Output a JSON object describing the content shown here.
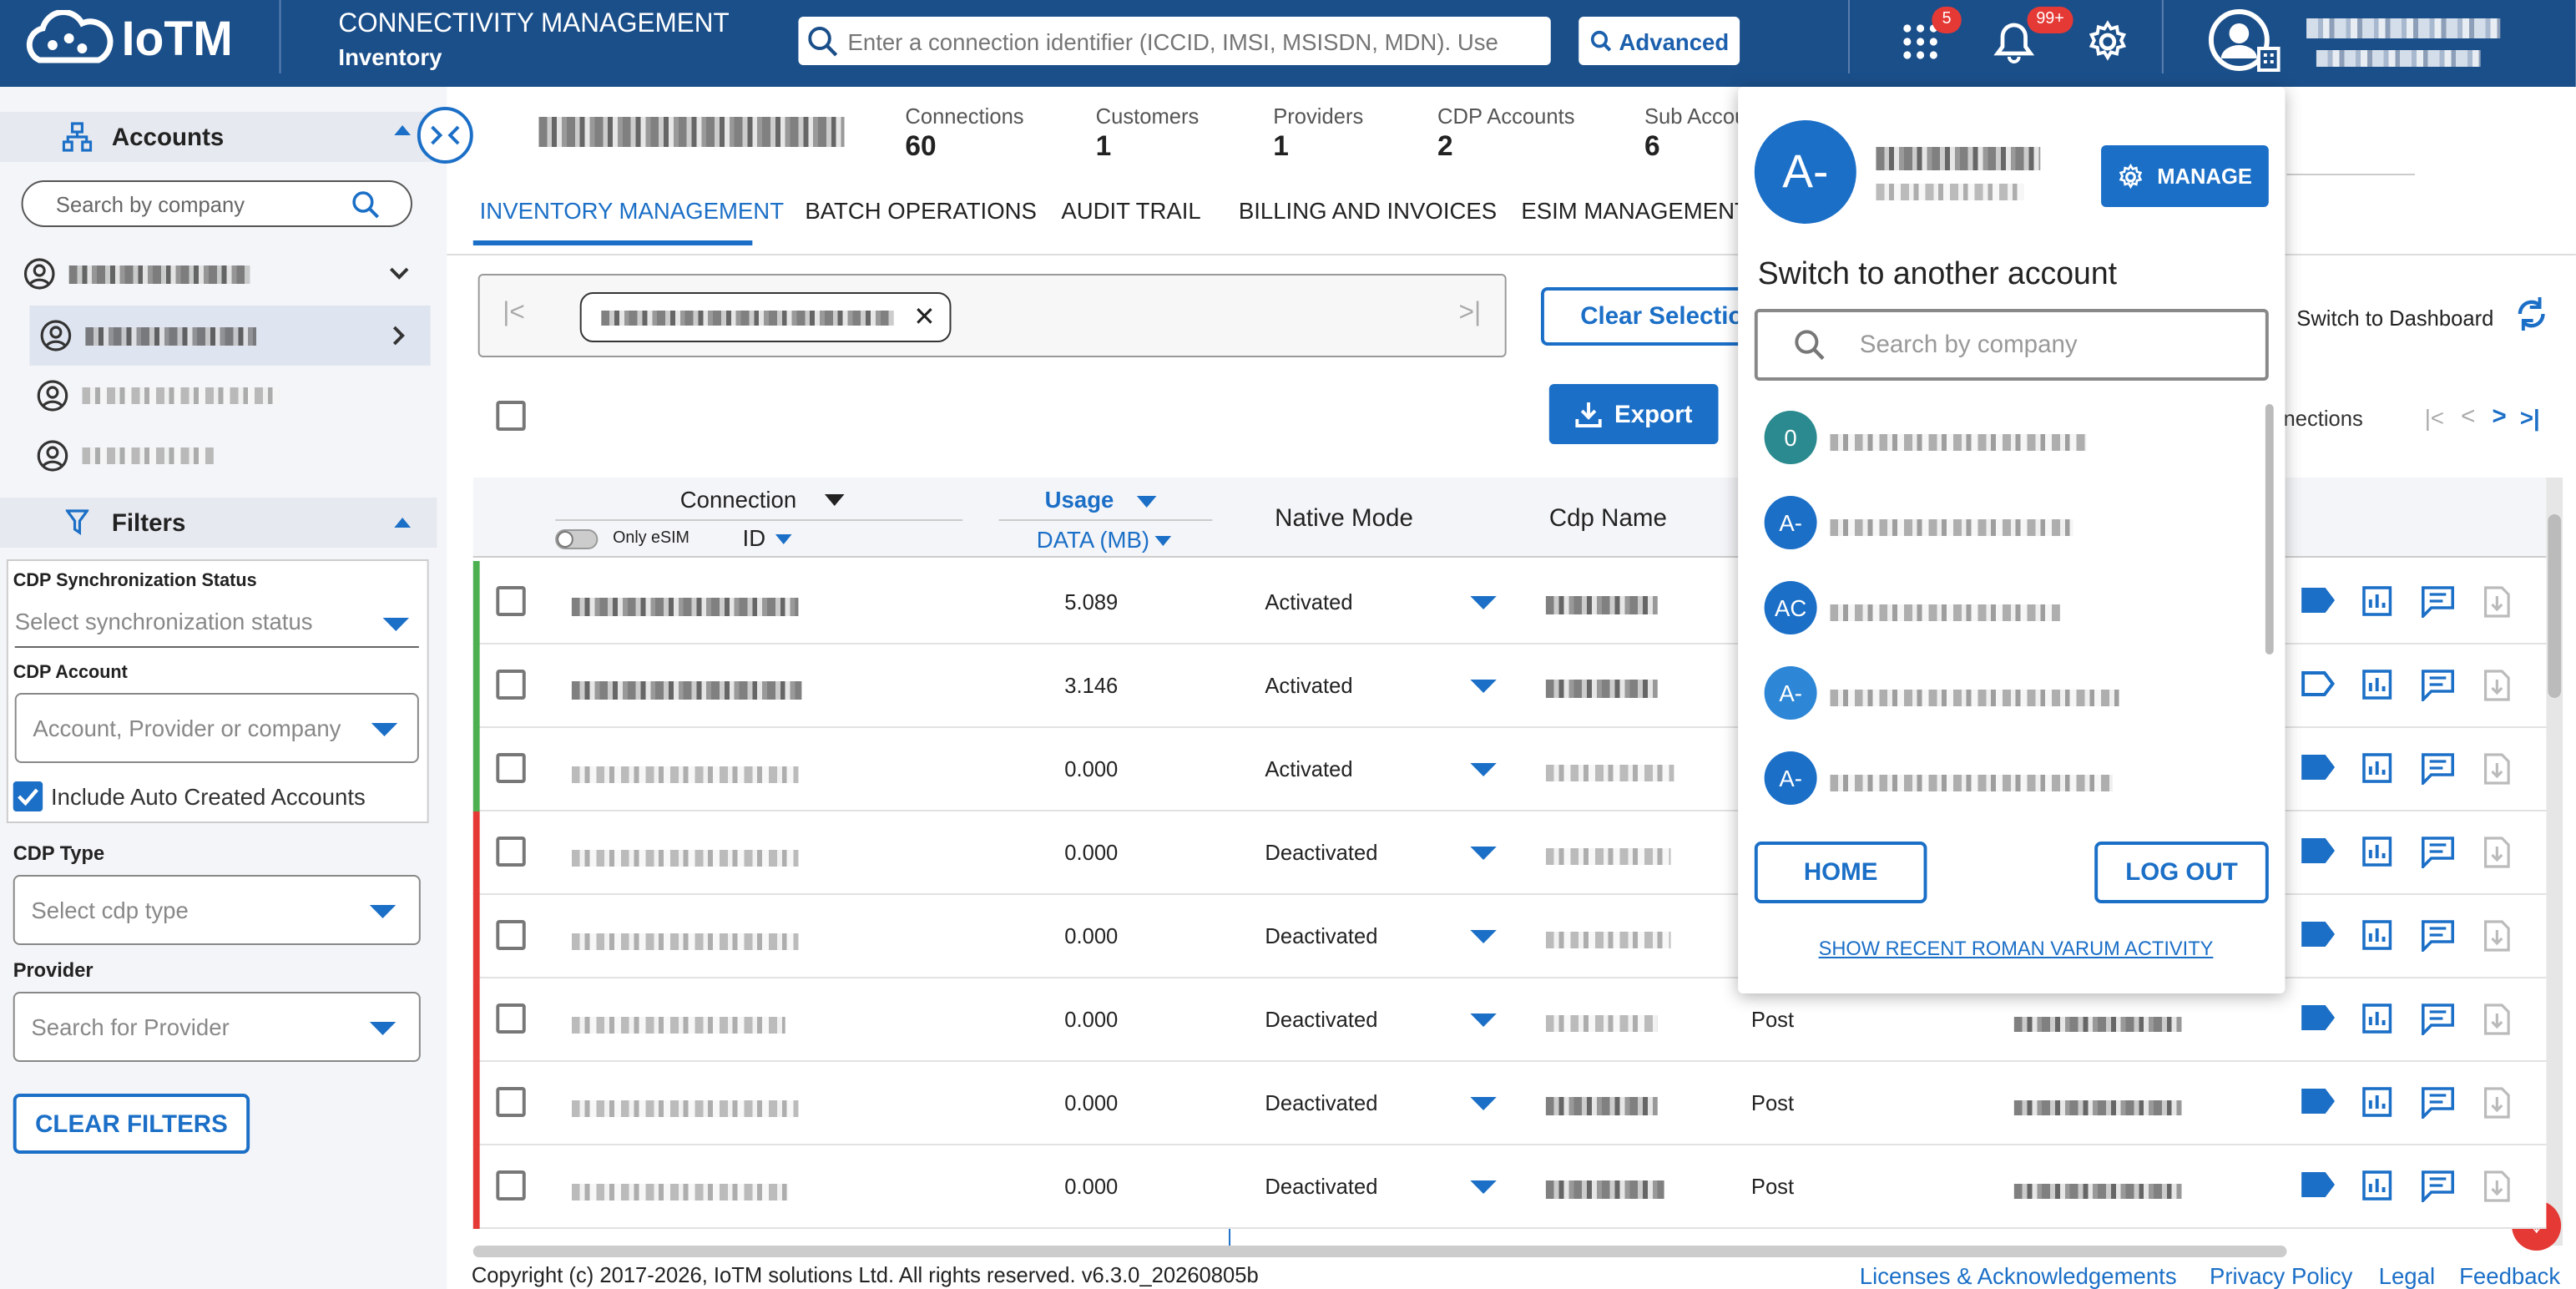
{
  "header": {
    "logo_text": "IoTM",
    "title": "CONNECTIVITY MANAGEMENT",
    "subtitle": "Inventory",
    "search_placeholder": "Enter a connection identifier (ICCID, IMSI, MSISDN, MDN). Use",
    "advanced_label": "Advanced",
    "apps_badge": "5",
    "notifications_badge": "99+"
  },
  "sidebar": {
    "accounts_title": "Accounts",
    "search_placeholder": "Search by company",
    "filters_title": "Filters",
    "cdp_sync_label": "CDP Synchronization Status",
    "cdp_sync_placeholder": "Select synchronization status",
    "cdp_account_label": "CDP Account",
    "cdp_account_placeholder": "Account, Provider or company",
    "include_auto_label": "Include Auto Created Accounts",
    "cdp_type_label": "CDP Type",
    "cdp_type_placeholder": "Select cdp type",
    "provider_label": "Provider",
    "provider_placeholder": "Search for Provider",
    "clear_filters_label": "CLEAR FILTERS"
  },
  "stats": [
    {
      "label": "Connections",
      "value": "60"
    },
    {
      "label": "Customers",
      "value": "1"
    },
    {
      "label": "Providers",
      "value": "1"
    },
    {
      "label": "CDP Accounts",
      "value": "2"
    },
    {
      "label": "Sub Accou",
      "value": "6"
    }
  ],
  "tabs": [
    {
      "label": "INVENTORY MANAGEMENT"
    },
    {
      "label": "BATCH OPERATIONS"
    },
    {
      "label": "AUDIT TRAIL"
    },
    {
      "label": "BILLING AND INVOICES"
    },
    {
      "label": "ESIM MANAGEMENT"
    }
  ],
  "toolbar": {
    "clear_selection_label": "Clear Selectio",
    "export_label": "Export",
    "switch_dashboard_label": "Switch to Dashboard",
    "pager_label": "nections"
  },
  "table": {
    "col_connection": "Connection",
    "col_id": "ID",
    "only_esim": "Only eSIM",
    "col_usage": "Usage",
    "col_data": "DATA (MB)",
    "col_native": "Native Mode",
    "col_cdp": "Cdp Name",
    "rows": [
      {
        "usage": "5.089",
        "mode": "Activated",
        "plan": "",
        "status_color": "#4caf50",
        "tag_filled": true
      },
      {
        "usage": "3.146",
        "mode": "Activated",
        "plan": "",
        "status_color": "#4caf50",
        "tag_filled": false
      },
      {
        "usage": "0.000",
        "mode": "Activated",
        "plan": "",
        "status_color": "#4caf50",
        "tag_filled": true
      },
      {
        "usage": "0.000",
        "mode": "Deactivated",
        "plan": "",
        "status_color": "#e53935",
        "tag_filled": true
      },
      {
        "usage": "0.000",
        "mode": "Deactivated",
        "plan": "",
        "status_color": "#e53935",
        "tag_filled": true
      },
      {
        "usage": "0.000",
        "mode": "Deactivated",
        "plan": "Post",
        "status_color": "#e53935",
        "tag_filled": true
      },
      {
        "usage": "0.000",
        "mode": "Deactivated",
        "plan": "Post",
        "status_color": "#e53935",
        "tag_filled": true
      },
      {
        "usage": "0.000",
        "mode": "Deactivated",
        "plan": "Post",
        "status_color": "#e53935",
        "tag_filled": true
      }
    ]
  },
  "popup": {
    "avatar": "A-",
    "manage_label": "MANAGE",
    "switch_title": "Switch to another account",
    "search_placeholder": "Search by company",
    "accounts": [
      {
        "initials": "0",
        "color": "#2a8a8f"
      },
      {
        "initials": "A-",
        "color": "#1b6fc7"
      },
      {
        "initials": "AC",
        "color": "#1b6fc7"
      },
      {
        "initials": "A-",
        "color": "#2d87d6"
      },
      {
        "initials": "A-",
        "color": "#1b6fc7"
      }
    ],
    "home_label": "HOME",
    "logout_label": "LOG OUT",
    "recent_label": "SHOW RECENT ROMAN VARUM ACTIVITY"
  },
  "footer": {
    "copyright": "Copyright (c) 2017-2026, IoTM solutions Ltd. All rights reserved. v6.3.0_20260805b",
    "links": [
      "Licenses & Acknowledgements",
      "Privacy Policy",
      "Legal",
      "Feedback"
    ]
  },
  "colors": {
    "brand": "#1b4f8a",
    "accent": "#1b6fc7",
    "active": "#4caf50",
    "inactive": "#e53935"
  }
}
